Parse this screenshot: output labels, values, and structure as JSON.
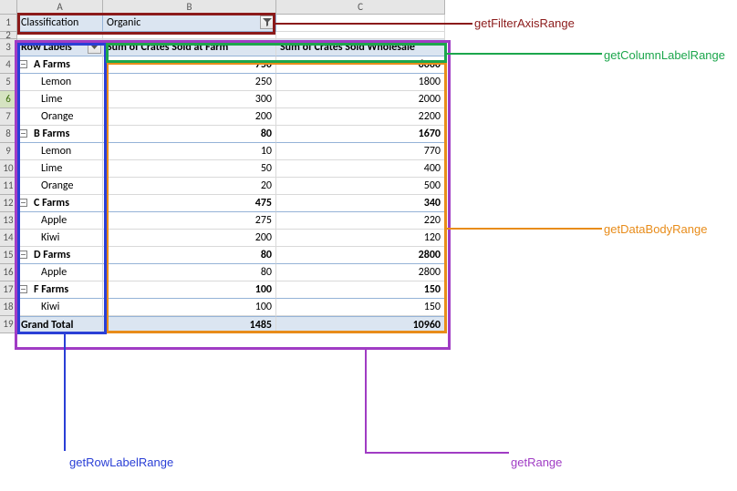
{
  "cols": {
    "A": "A",
    "B": "B",
    "C": "C"
  },
  "filter": {
    "field": "Classification",
    "value": "Organic"
  },
  "header": {
    "rowLabels": "Row Labels",
    "col1": "Sum of Crates Sold at Farm",
    "col2": "Sum of Crates Sold Wholesale"
  },
  "rows": [
    {
      "type": "group",
      "label": "A Farms",
      "v1": "750",
      "v2": "6000"
    },
    {
      "type": "child",
      "label": "Lemon",
      "v1": "250",
      "v2": "1800"
    },
    {
      "type": "child",
      "label": "Lime",
      "v1": "300",
      "v2": "2000"
    },
    {
      "type": "child",
      "label": "Orange",
      "v1": "200",
      "v2": "2200"
    },
    {
      "type": "group",
      "label": "B Farms",
      "v1": "80",
      "v2": "1670"
    },
    {
      "type": "child",
      "label": "Lemon",
      "v1": "10",
      "v2": "770"
    },
    {
      "type": "child",
      "label": "Lime",
      "v1": "50",
      "v2": "400"
    },
    {
      "type": "child",
      "label": "Orange",
      "v1": "20",
      "v2": "500"
    },
    {
      "type": "group",
      "label": "C Farms",
      "v1": "475",
      "v2": "340"
    },
    {
      "type": "child",
      "label": "Apple",
      "v1": "275",
      "v2": "220"
    },
    {
      "type": "child",
      "label": "Kiwi",
      "v1": "200",
      "v2": "120"
    },
    {
      "type": "group",
      "label": "D Farms",
      "v1": "80",
      "v2": "2800"
    },
    {
      "type": "child",
      "label": "Apple",
      "v1": "80",
      "v2": "2800"
    },
    {
      "type": "group",
      "label": "F Farms",
      "v1": "100",
      "v2": "150"
    },
    {
      "type": "child",
      "label": "Kiwi",
      "v1": "100",
      "v2": "150"
    }
  ],
  "grand": {
    "label": "Grand Total",
    "v1": "1485",
    "v2": "10960"
  },
  "annotations": {
    "filter": "getFilterAxisRange",
    "colLabel": "getColumnLabelRange",
    "dataBody": "getDataBodyRange",
    "range": "getRange",
    "rowLabel": "getRowLabelRange"
  }
}
